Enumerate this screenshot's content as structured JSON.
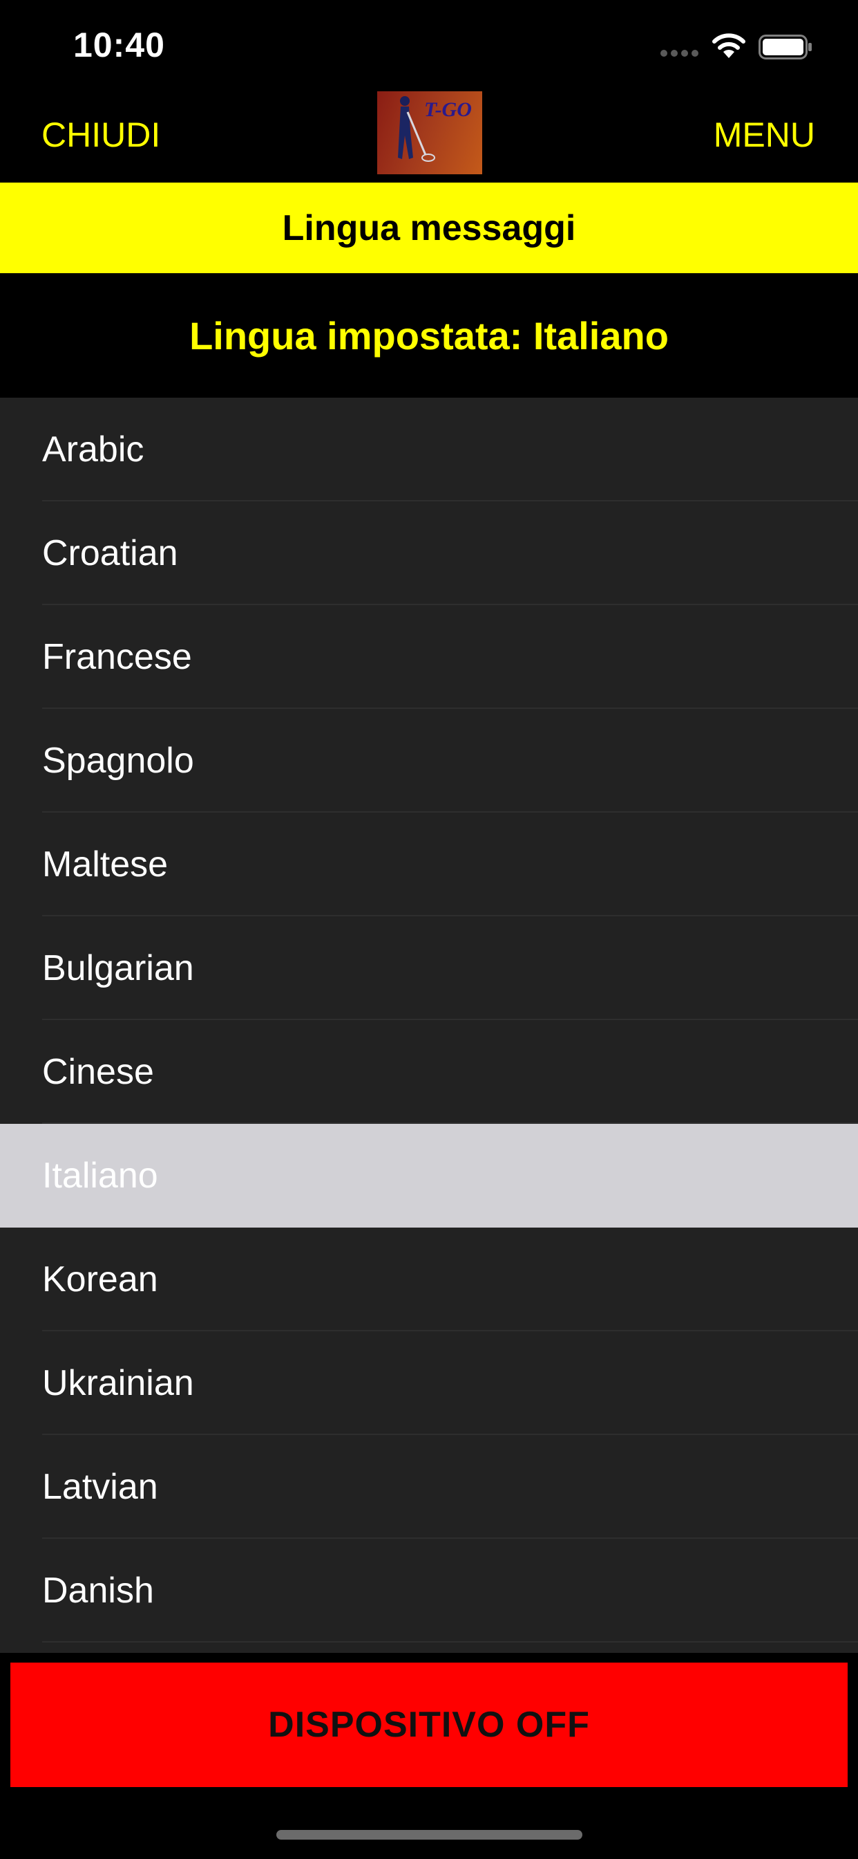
{
  "status_bar": {
    "time": "10:40",
    "icons": [
      "signal-dots-icon",
      "wifi-icon",
      "battery-icon"
    ]
  },
  "nav": {
    "close_label": "CHIUDI",
    "menu_label": "MENU",
    "logo_text": "T-GO",
    "logo_icon": "person-with-cane-logo"
  },
  "title_band": {
    "text": "Lingua messaggi"
  },
  "current_language": {
    "text": "Lingua impostata: Italiano"
  },
  "languages": [
    {
      "label": "Arabic",
      "selected": false
    },
    {
      "label": "Croatian",
      "selected": false
    },
    {
      "label": "Francese",
      "selected": false
    },
    {
      "label": "Spagnolo",
      "selected": false
    },
    {
      "label": "Maltese",
      "selected": false
    },
    {
      "label": "Bulgarian",
      "selected": false
    },
    {
      "label": "Cinese",
      "selected": false
    },
    {
      "label": "Italiano",
      "selected": true
    },
    {
      "label": "Korean",
      "selected": false
    },
    {
      "label": "Ukrainian",
      "selected": false
    },
    {
      "label": "Latvian",
      "selected": false
    },
    {
      "label": "Danish",
      "selected": false
    }
  ],
  "device_button": {
    "label": "DISPOSITIVO OFF"
  },
  "colors": {
    "accent_yellow": "#ffff00",
    "alert_red": "#ff0000",
    "list_background": "#222222",
    "selected_row": "#d2d1d6"
  }
}
